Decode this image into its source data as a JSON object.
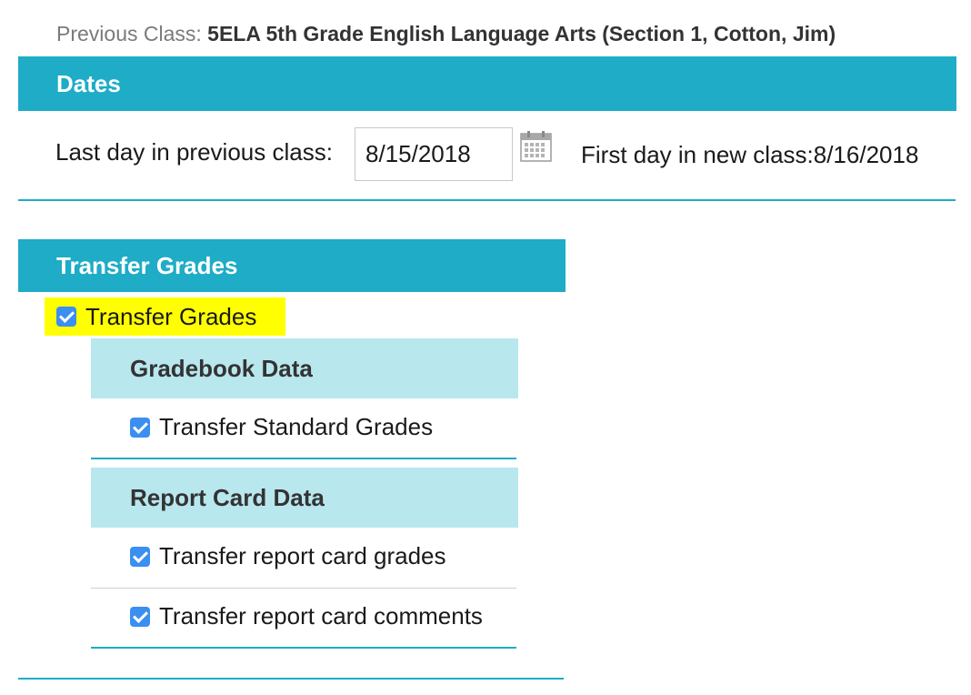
{
  "previous_class": {
    "label": "Previous Class:",
    "value": "5ELA 5th Grade English Language Arts (Section 1, Cotton, Jim)"
  },
  "dates": {
    "header": "Dates",
    "last_day_label": "Last day in previous class:",
    "last_day_value": "8/15/2018",
    "first_day_label": "First day in new class:8/16/2018",
    "calendar_icon": "calendar-icon"
  },
  "transfer_grades": {
    "header": "Transfer Grades",
    "main_checkbox_label": "Transfer Grades",
    "main_checked": true,
    "highlight_color": "#ffff00",
    "gradebook": {
      "header": "Gradebook Data",
      "options": [
        {
          "label": "Transfer Standard Grades",
          "checked": true
        }
      ]
    },
    "report_card": {
      "header": "Report Card Data",
      "options": [
        {
          "label": "Transfer report card grades",
          "checked": true
        },
        {
          "label": "Transfer report card comments",
          "checked": true
        }
      ]
    }
  },
  "colors": {
    "header_bg": "#1eacc6",
    "subheader_bg": "#b8e7ee",
    "checkbox": "#3a8ff0"
  }
}
